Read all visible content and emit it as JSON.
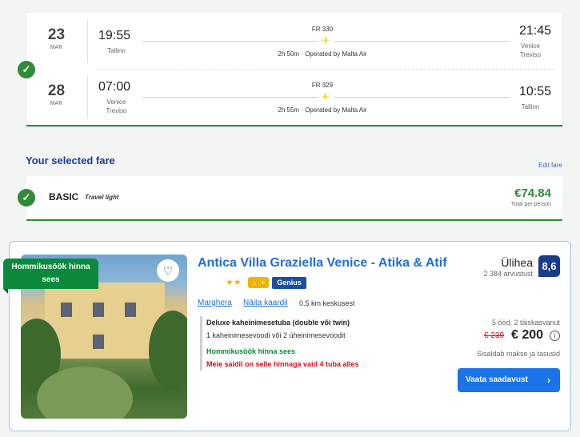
{
  "flight": {
    "outbound": {
      "day": "23",
      "month": "MAR",
      "dep_time": "19:55",
      "dep_place": "Tallinn",
      "flight_no": "FR 330",
      "duration": "2h 50m · Operated by Malta Air",
      "arr_time": "21:45",
      "arr_place": "Venice\nTreviso"
    },
    "inbound": {
      "day": "28",
      "month": "MAR",
      "dep_time": "07:00",
      "dep_place": "Venice\nTreviso",
      "flight_no": "FR 329",
      "duration": "2h 55m · Operated by Malta Air",
      "arr_time": "10:55",
      "arr_place": "Tallinn"
    }
  },
  "fare": {
    "section_title": "Your selected fare",
    "edit_label": "Edit fare",
    "name": "BASIC",
    "subtitle": "Travel light",
    "price": "€74.84",
    "price_note": "Total per person"
  },
  "hotel": {
    "badge": "Hommikusöök hinna sees",
    "name": "Antica Villa Graziella Venice - Atika & Atif",
    "stars": "★★",
    "genius_label": "Genius",
    "location_city": "Marghera",
    "location_map": "Näita kaardil",
    "distance": "0.5 km keskusest",
    "room_type": "Deluxe kaheinimesetuba (double või twin)",
    "room_beds": "1 kaheinimesevoodi või 2 üheinimesevoodit",
    "breakfast": "Hommikusöök hinna sees",
    "rooms_left": "Meie saidil on selle hinnaga vaid 4 tuba alles",
    "score_label": "Ülihea",
    "reviews": "2 384 arvustust",
    "score": "8,6",
    "stay_info": "5 ööd, 2 täiskasvanut",
    "old_price": "€ 239",
    "new_price": "€ 200",
    "taxes_note": "Sisaldab makse ja tasusid",
    "cta_label": "Vaata saadavust"
  },
  "colors": {
    "accent_green": "#2f8a3c",
    "brand_blue": "#1a73e8",
    "title_blue": "#1f3d8a",
    "price_red": "#d4111e"
  },
  "icons": [
    "check-icon",
    "plane-icon",
    "heart-icon",
    "thumbs-up-icon",
    "info-icon",
    "chevron-right-icon"
  ]
}
